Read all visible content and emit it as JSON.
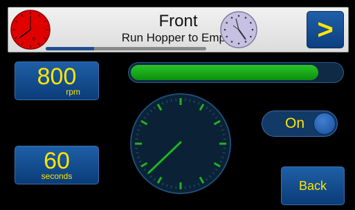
{
  "header": {
    "title": "Front",
    "subtitle": "Run Hopper to Empty",
    "progress_fraction": 0.3,
    "next_label": ">",
    "red_dial_value": "0"
  },
  "speed": {
    "value": "800",
    "unit": "rpm"
  },
  "duration": {
    "value": "60",
    "unit": "seconds"
  },
  "progress_bar": {
    "fraction": 0.89
  },
  "toggle": {
    "label": "On",
    "state": "on"
  },
  "back_label": "Back",
  "icons": {
    "red_dial": "red-gauge-icon",
    "clock": "clock-icon",
    "timer": "timer-dial-icon"
  },
  "colors": {
    "accent_yellow": "#ffe600",
    "button_blue": "#1e5fa6",
    "progress_green": "#1fb51f",
    "gauge_red": "#e00000"
  }
}
